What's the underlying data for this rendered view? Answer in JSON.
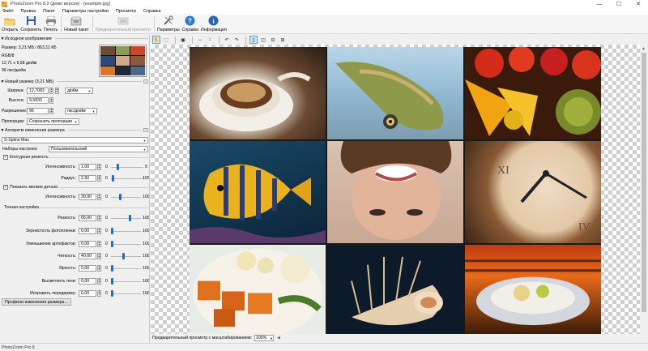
{
  "window": {
    "title": "PhotoZoom Pro 8.2 (демо версия) - [example.jpg]",
    "min": "—",
    "max": "☐",
    "close": "✕"
  },
  "menu": [
    "Файл",
    "Правка",
    "Пакет",
    "Параметры настройки",
    "Просмотр",
    "Справка"
  ],
  "toolbar": {
    "buttons": [
      {
        "label": "Открыть",
        "icon": "folder-icon",
        "enabled": true
      },
      {
        "label": "Сохранить",
        "icon": "floppy-icon",
        "enabled": true
      },
      {
        "label": "Печать",
        "icon": "printer-icon",
        "enabled": true
      },
      {
        "label": "Новый пакет",
        "icon": "batch-icon",
        "enabled": true
      },
      {
        "label": "Предварительный просмотр",
        "icon": "preview-icon",
        "enabled": false
      },
      {
        "label": "Параметры",
        "icon": "tools-icon",
        "enabled": true
      },
      {
        "label": "Справка",
        "icon": "help-icon",
        "enabled": true
      },
      {
        "label": "Информация",
        "icon": "info-icon",
        "enabled": true
      }
    ]
  },
  "source": {
    "header": "Исходное изображение",
    "size": "Размер: 3,21 МБ / 863,11 КБ",
    "mode": "RGB/8",
    "dims": "12,71 x 9,58 дюйм",
    "dpi": "96 пкс/дюйм"
  },
  "newsize": {
    "header": "Новый размер (3,21 МБ)",
    "width_label": "Ширина:",
    "width": "12,7083",
    "height_label": "Высота:",
    "height": "9,5833",
    "unit": "дюйм",
    "res_label": "Разрешение:",
    "res": "96",
    "res_unit": "пкс/дюйм",
    "prop_label": "Пропорции:",
    "prop": "Сохранить пропорции"
  },
  "algo": {
    "header": "Алгоритм изменения размера",
    "method": "S-Spline Max",
    "preset_label": "Наборы настроек:",
    "preset": "Пользовательский"
  },
  "sharpness": {
    "check_label": "Контурная резкость",
    "checked": true,
    "intensity_label": "Интенсивность:",
    "intensity": "1,00",
    "intensity_min": "0",
    "intensity_max": "5",
    "intensity_level": 0.2,
    "radius_label": "Радиус:",
    "radius": "2,50",
    "radius_min": "0",
    "radius_max": "100",
    "radius_level": 0.025
  },
  "details": {
    "check_label": "Показать мелкие детали",
    "checked": true,
    "intensity_label": "Интенсивность:",
    "intensity": "30,00",
    "min": "0",
    "max": "100",
    "level": 0.3
  },
  "fine": {
    "header": "Точная настройка",
    "rows": [
      {
        "label": "Резкость:",
        "value": "65,00",
        "min": "0",
        "max": "100",
        "level": 0.65
      },
      {
        "label": "Зернистость фотопленки:",
        "value": "0,00",
        "min": "0",
        "max": "100",
        "level": 0
      },
      {
        "label": "Уменьшение артефактов:",
        "value": "0,00",
        "min": "0",
        "max": "100",
        "level": 0
      },
      {
        "label": "Четкость:",
        "value": "40,00",
        "min": "0",
        "max": "100",
        "level": 0.4
      },
      {
        "label": "Яркость:",
        "value": "0,00",
        "min": "0",
        "max": "100",
        "level": 0
      },
      {
        "label": "Высветлить тени:",
        "value": "0,00",
        "min": "0",
        "max": "100",
        "level": 0
      },
      {
        "label": "Исправить передержку:",
        "value": "0,00",
        "min": "0",
        "max": "100",
        "level": 0
      }
    ]
  },
  "profiles_button": "Профили изменения размера...",
  "preview": {
    "zoom_label": "Предварительный просмотр с масштабированием:",
    "zoom": "100%"
  },
  "status": "PhotoZoom Pro 8",
  "accent": "#1f6fd0"
}
